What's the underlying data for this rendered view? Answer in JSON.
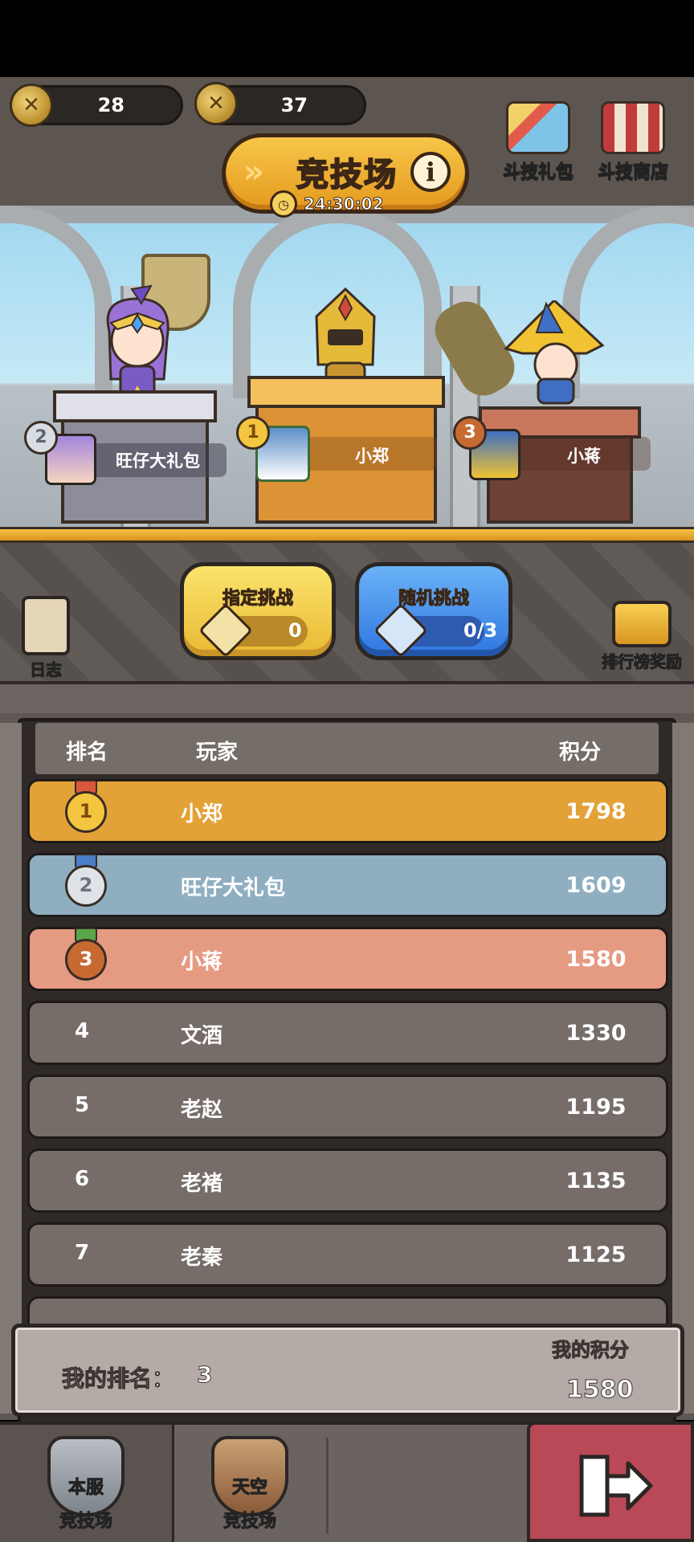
{
  "currency": [
    {
      "icon": "coin-icon",
      "value": "28"
    },
    {
      "icon": "gold-medal-coin-icon",
      "value": "37"
    }
  ],
  "top_buttons": [
    {
      "label": "斗技礼包",
      "icon": "gift-pack-icon"
    },
    {
      "label": "斗技商店",
      "icon": "shop-stall-icon"
    }
  ],
  "title": {
    "text": "竞技场",
    "timer": "24:30:02"
  },
  "podium": [
    {
      "rank": "2",
      "name": "旺仔大礼包"
    },
    {
      "rank": "1",
      "name": "小郑"
    },
    {
      "rank": "3",
      "name": "小蒋"
    }
  ],
  "side_left": {
    "label": "日志"
  },
  "side_right": {
    "label": "排行榜奖励"
  },
  "challenges": [
    {
      "label": "指定挑战",
      "count": "0"
    },
    {
      "label": "随机挑战",
      "count": "0/3"
    }
  ],
  "board": {
    "headers": {
      "rank": "排名",
      "player": "玩家",
      "score": "积分"
    },
    "rows": [
      {
        "rank": "1",
        "name": "小郑",
        "score": "1798"
      },
      {
        "rank": "2",
        "name": "旺仔大礼包",
        "score": "1609"
      },
      {
        "rank": "3",
        "name": "小蒋",
        "score": "1580"
      },
      {
        "rank": "4",
        "name": "文酒",
        "score": "1330"
      },
      {
        "rank": "5",
        "name": "老赵",
        "score": "1195"
      },
      {
        "rank": "6",
        "name": "老褚",
        "score": "1135"
      },
      {
        "rank": "7",
        "name": "老秦",
        "score": "1125"
      }
    ]
  },
  "my": {
    "rank_label": "我的排名：",
    "rank": "3",
    "score_label": "我的积分",
    "score": "1580"
  },
  "tabs": [
    {
      "line1": "本服",
      "line2": "竞技场"
    },
    {
      "line1": "天空",
      "line2": "竞技场"
    }
  ],
  "colors": {
    "row_gold": "#e3a237",
    "row_silver": "#8fafc1",
    "row_bronze": "#e59a82",
    "row_normal": "#766d69"
  }
}
